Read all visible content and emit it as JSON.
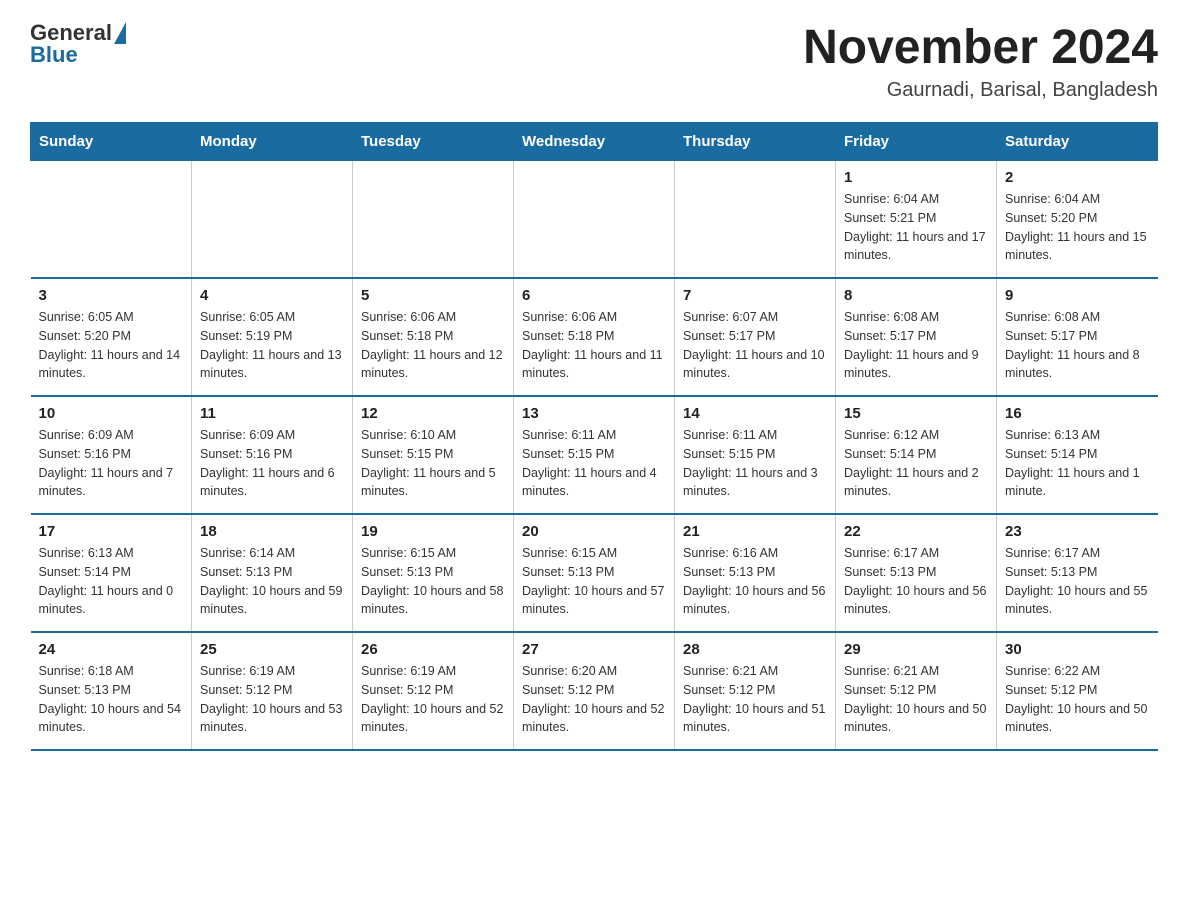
{
  "header": {
    "logo_general": "General",
    "logo_blue": "Blue",
    "month_title": "November 2024",
    "location": "Gaurnadi, Barisal, Bangladesh"
  },
  "weekdays": [
    "Sunday",
    "Monday",
    "Tuesday",
    "Wednesday",
    "Thursday",
    "Friday",
    "Saturday"
  ],
  "weeks": [
    [
      {
        "day": "",
        "info": ""
      },
      {
        "day": "",
        "info": ""
      },
      {
        "day": "",
        "info": ""
      },
      {
        "day": "",
        "info": ""
      },
      {
        "day": "",
        "info": ""
      },
      {
        "day": "1",
        "info": "Sunrise: 6:04 AM\nSunset: 5:21 PM\nDaylight: 11 hours and 17 minutes."
      },
      {
        "day": "2",
        "info": "Sunrise: 6:04 AM\nSunset: 5:20 PM\nDaylight: 11 hours and 15 minutes."
      }
    ],
    [
      {
        "day": "3",
        "info": "Sunrise: 6:05 AM\nSunset: 5:20 PM\nDaylight: 11 hours and 14 minutes."
      },
      {
        "day": "4",
        "info": "Sunrise: 6:05 AM\nSunset: 5:19 PM\nDaylight: 11 hours and 13 minutes."
      },
      {
        "day": "5",
        "info": "Sunrise: 6:06 AM\nSunset: 5:18 PM\nDaylight: 11 hours and 12 minutes."
      },
      {
        "day": "6",
        "info": "Sunrise: 6:06 AM\nSunset: 5:18 PM\nDaylight: 11 hours and 11 minutes."
      },
      {
        "day": "7",
        "info": "Sunrise: 6:07 AM\nSunset: 5:17 PM\nDaylight: 11 hours and 10 minutes."
      },
      {
        "day": "8",
        "info": "Sunrise: 6:08 AM\nSunset: 5:17 PM\nDaylight: 11 hours and 9 minutes."
      },
      {
        "day": "9",
        "info": "Sunrise: 6:08 AM\nSunset: 5:17 PM\nDaylight: 11 hours and 8 minutes."
      }
    ],
    [
      {
        "day": "10",
        "info": "Sunrise: 6:09 AM\nSunset: 5:16 PM\nDaylight: 11 hours and 7 minutes."
      },
      {
        "day": "11",
        "info": "Sunrise: 6:09 AM\nSunset: 5:16 PM\nDaylight: 11 hours and 6 minutes."
      },
      {
        "day": "12",
        "info": "Sunrise: 6:10 AM\nSunset: 5:15 PM\nDaylight: 11 hours and 5 minutes."
      },
      {
        "day": "13",
        "info": "Sunrise: 6:11 AM\nSunset: 5:15 PM\nDaylight: 11 hours and 4 minutes."
      },
      {
        "day": "14",
        "info": "Sunrise: 6:11 AM\nSunset: 5:15 PM\nDaylight: 11 hours and 3 minutes."
      },
      {
        "day": "15",
        "info": "Sunrise: 6:12 AM\nSunset: 5:14 PM\nDaylight: 11 hours and 2 minutes."
      },
      {
        "day": "16",
        "info": "Sunrise: 6:13 AM\nSunset: 5:14 PM\nDaylight: 11 hours and 1 minute."
      }
    ],
    [
      {
        "day": "17",
        "info": "Sunrise: 6:13 AM\nSunset: 5:14 PM\nDaylight: 11 hours and 0 minutes."
      },
      {
        "day": "18",
        "info": "Sunrise: 6:14 AM\nSunset: 5:13 PM\nDaylight: 10 hours and 59 minutes."
      },
      {
        "day": "19",
        "info": "Sunrise: 6:15 AM\nSunset: 5:13 PM\nDaylight: 10 hours and 58 minutes."
      },
      {
        "day": "20",
        "info": "Sunrise: 6:15 AM\nSunset: 5:13 PM\nDaylight: 10 hours and 57 minutes."
      },
      {
        "day": "21",
        "info": "Sunrise: 6:16 AM\nSunset: 5:13 PM\nDaylight: 10 hours and 56 minutes."
      },
      {
        "day": "22",
        "info": "Sunrise: 6:17 AM\nSunset: 5:13 PM\nDaylight: 10 hours and 56 minutes."
      },
      {
        "day": "23",
        "info": "Sunrise: 6:17 AM\nSunset: 5:13 PM\nDaylight: 10 hours and 55 minutes."
      }
    ],
    [
      {
        "day": "24",
        "info": "Sunrise: 6:18 AM\nSunset: 5:13 PM\nDaylight: 10 hours and 54 minutes."
      },
      {
        "day": "25",
        "info": "Sunrise: 6:19 AM\nSunset: 5:12 PM\nDaylight: 10 hours and 53 minutes."
      },
      {
        "day": "26",
        "info": "Sunrise: 6:19 AM\nSunset: 5:12 PM\nDaylight: 10 hours and 52 minutes."
      },
      {
        "day": "27",
        "info": "Sunrise: 6:20 AM\nSunset: 5:12 PM\nDaylight: 10 hours and 52 minutes."
      },
      {
        "day": "28",
        "info": "Sunrise: 6:21 AM\nSunset: 5:12 PM\nDaylight: 10 hours and 51 minutes."
      },
      {
        "day": "29",
        "info": "Sunrise: 6:21 AM\nSunset: 5:12 PM\nDaylight: 10 hours and 50 minutes."
      },
      {
        "day": "30",
        "info": "Sunrise: 6:22 AM\nSunset: 5:12 PM\nDaylight: 10 hours and 50 minutes."
      }
    ]
  ]
}
